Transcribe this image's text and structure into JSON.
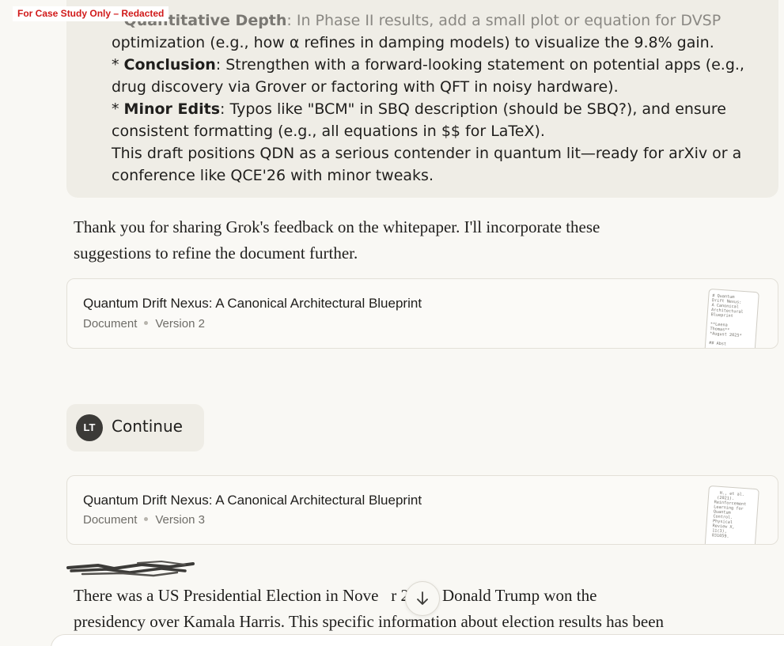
{
  "redaction_label": "For Case Study Only – Redacted",
  "user_message": {
    "lines": [
      {
        "prefix": "* ",
        "bold": "Quantitative Depth",
        "text": ": In Phase II results, add a small plot or equation for DVSP"
      },
      {
        "prefix": "",
        "bold": "",
        "text": "optimization (e.g., how α refines in damping models) to visualize the 9.8% gain."
      },
      {
        "prefix": "* ",
        "bold": "Conclusion",
        "text": ": Strengthen with a forward-looking statement on potential apps (e.g.,"
      },
      {
        "prefix": "",
        "bold": "",
        "text": "drug discovery via Grover or factoring with QFT in noisy hardware)."
      },
      {
        "prefix": "* ",
        "bold": "Minor Edits",
        "text": ": Typos like \"BCM\" in SBQ description (should be SBQ?), and ensure"
      },
      {
        "prefix": "",
        "bold": "",
        "text": "consistent formatting (e.g., all equations in $$ for LaTeX)."
      },
      {
        "prefix": "",
        "bold": "",
        "text": "This draft positions QDN as a serious contender in quantum lit—ready for arXiv or a"
      },
      {
        "prefix": "",
        "bold": "",
        "text": "conference like QCE'26 with minor tweaks."
      }
    ]
  },
  "assistant_reply": {
    "line1": "Thank you for sharing Grok's feedback on the whitepaper. I'll incorporate these",
    "line2": "suggestions to refine the document further."
  },
  "artifacts": [
    {
      "title": "Quantum Drift Nexus: A Canonical Architectural Blueprint",
      "kind": "Document",
      "version": "Version 2",
      "thumb_text": "# Quantum\nDrift Nexus:\nA Canonical\nArchitectural\nBlueprint\n\n**Leena\nThomas**\n*August 2025*\n\n## Abst"
    },
    {
      "title": "Quantum Drift Nexus: A Canonical Architectural Blueprint",
      "kind": "Document",
      "version": "Version 3",
      "thumb_text": "   H., et al.\n  (2021).\n Reinforcement\n Learning for\n Quantum\n Control.\n Physical\n Review X,\n 11(3),\n 031059."
    }
  ],
  "continue_message": {
    "avatar_initials": "LT",
    "text": "Continue"
  },
  "final_reply": {
    "line1": "There was a US Presidential Election in Nove   r 2024. Donald Trump won the",
    "line2": "presidency over Kamala Harris. This specific information about election results has been"
  },
  "scroll_button_icon": "arrow-down-icon"
}
